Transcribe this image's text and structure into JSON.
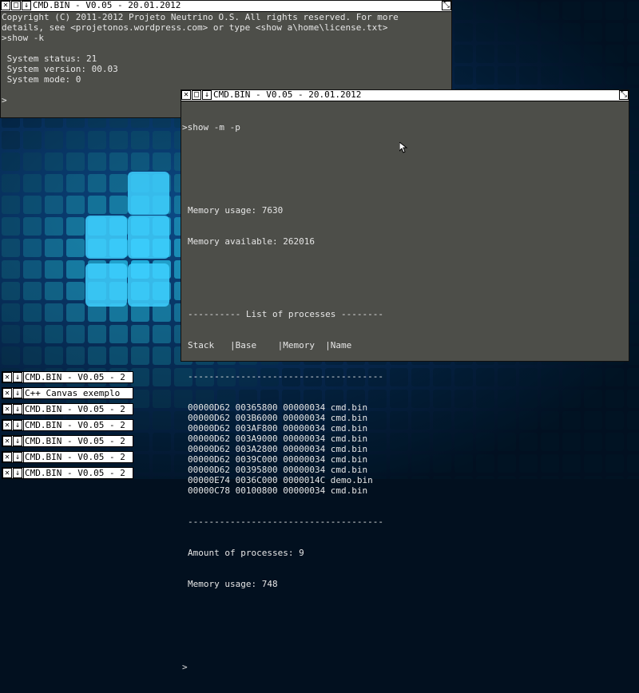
{
  "window1": {
    "title": "CMD.BIN - V0.05 - 20.01.2012",
    "lines": [
      "Copyright (C) 2011-2012 Projeto Neutrino O.S. All rights reserved. For more",
      "details, see <projetonos.wordpress.com> or type <show a\\home\\license.txt>",
      ">show -k",
      "",
      " System status: 21",
      " System version: 00.03",
      " System mode: 0",
      "",
      ">"
    ]
  },
  "window2": {
    "title": "CMD.BIN - V0.05 - 20.01.2012",
    "command": ">show -m -p",
    "memory_usage": "Memory usage: 7630",
    "memory_available": "Memory available: 262016",
    "list_header": "---------- List of processes --------",
    "columns": "Stack   |Base    |Memory  |Name",
    "separator": "-------------------------------------",
    "processes": [
      "00000D62 00365800 00000034 cmd.bin",
      "00000D62 003B6000 00000034 cmd.bin",
      "00000D62 003AF800 00000034 cmd.bin",
      "00000D62 003A9000 00000034 cmd.bin",
      "00000D62 003A2800 00000034 cmd.bin",
      "00000D62 0039C000 00000034 cmd.bin",
      "00000D62 00395800 00000034 cmd.bin",
      "00000E74 0036C000 0000014C demo.bin",
      "00000C78 00100800 00000034 cmd.bin"
    ],
    "separator2": "-------------------------------------",
    "amount": "Amount of processes: 9",
    "memory_usage_after": "Memory usage: 748",
    "prompt": ">"
  },
  "taskbar": [
    {
      "label": "CMD.BIN - V0.05 - 2"
    },
    {
      "label": "C++ Canvas exemplo"
    },
    {
      "label": "CMD.BIN - V0.05 - 2"
    },
    {
      "label": "CMD.BIN - V0.05 - 2"
    },
    {
      "label": "CMD.BIN - V0.05 - 2"
    },
    {
      "label": "CMD.BIN - V0.05 - 2"
    },
    {
      "label": "CMD.BIN - V0.05 - 2"
    }
  ],
  "icons": {
    "close": "close-icon",
    "maximize": "maximize-icon",
    "minimize": "minimize-icon",
    "resize": "resize-icon"
  },
  "colors": {
    "console_bg": "#4d4e49",
    "console_text": "#e6e6e6",
    "titlebar_bg": "#ffffff"
  }
}
